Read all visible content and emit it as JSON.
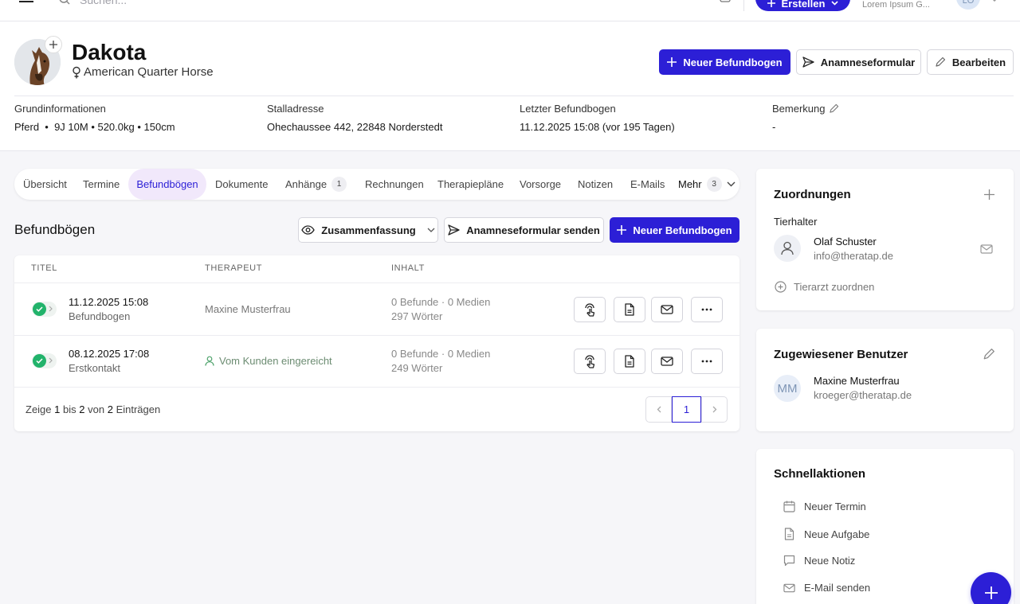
{
  "topbar": {
    "search_placeholder": "Suchen...",
    "create_label": "Erstellen",
    "company": "Lorem Ipsum G...",
    "user_initials": "LO"
  },
  "patient": {
    "name": "Dakota",
    "breed": "American Quarter Horse"
  },
  "header_buttons": {
    "new_form": "Neuer Befundbogen",
    "anamnesis": "Anamneseformular",
    "edit": "Bearbeiten"
  },
  "info": {
    "basic_label": "Grundinformationen",
    "basic_value": "Pferd  •  9J 10M • 520.0kg • 150cm",
    "stable_label": "Stalladresse",
    "stable_value": "Ohechaussee 442, 22848 Norderstedt",
    "last_label": "Letzter Befundbogen",
    "last_value": "11.12.2025 15:08 (vor 195 Tagen)",
    "note_label": "Bemerkung",
    "note_value": "-"
  },
  "tabs": [
    {
      "label": "Übersicht"
    },
    {
      "label": "Termine"
    },
    {
      "label": "Befundbögen"
    },
    {
      "label": "Dokumente"
    },
    {
      "label": "Anhänge",
      "badge": "1"
    },
    {
      "label": "Rechnungen"
    },
    {
      "label": "Therapiepläne"
    },
    {
      "label": "Vorsorge"
    },
    {
      "label": "Notizen"
    },
    {
      "label": "E-Mails"
    },
    {
      "label": "Mehr",
      "badge": "3"
    }
  ],
  "section": {
    "title": "Befundbögen",
    "summary": "Zusammenfassung",
    "send_anamnesis": "Anamneseformular senden",
    "new_form": "Neuer Befundbogen"
  },
  "table": {
    "headers": [
      "TITEL",
      "THERAPEUT",
      "INHALT"
    ],
    "rows": [
      {
        "date": "11.12.2025 15:08",
        "type": "Befundbogen",
        "therapist": "Maxine Musterfrau",
        "content1": "0 Befunde · 0 Medien",
        "content2": "297 Wörter"
      },
      {
        "date": "08.12.2025 17:08",
        "type": "Erstkontakt",
        "therapist": "Vom Kunden eingereicht",
        "content1": "0 Befunde · 0 Medien",
        "content2": "249 Wörter"
      }
    ],
    "pager": {
      "prefix": "Zeige",
      "from": "1",
      "mid": "bis",
      "to": "2",
      "of": "von",
      "total": "2",
      "suffix": "Einträgen",
      "current": "1"
    }
  },
  "assignments": {
    "title": "Zuordnungen",
    "owner_label": "Tierhalter",
    "owner_name": "Olaf Schuster",
    "owner_email": "info@theratap.de",
    "assign_vet": "Tierarzt zuordnen"
  },
  "assigned_user": {
    "title": "Zugewiesener Benutzer",
    "initials": "MM",
    "name": "Maxine Musterfrau",
    "email": "kroeger@theratap.de"
  },
  "quick_actions": {
    "title": "Schnellaktionen",
    "items": [
      "Neuer Termin",
      "Neue Aufgabe",
      "Neue Notiz",
      "E-Mail senden"
    ]
  },
  "colors": {
    "primary": "#2c1fd6",
    "success": "#22b36b",
    "tab_active_bg": "#f1e8fb"
  }
}
